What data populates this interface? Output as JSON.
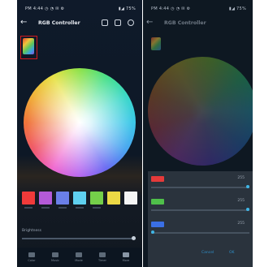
{
  "left_screen": {
    "status_left": "PM 4:44 ◷ ◔ ✉ ⚙",
    "status_right": "▮◢ 75%",
    "title": "RGB Controller",
    "swatches": [
      "#f03a3a",
      "#b45ad8",
      "#6a7fe8",
      "#5fd0f0",
      "#74cf4a",
      "#ecd845",
      "#f5f5f5"
    ],
    "brightness_label": "Brightness",
    "brightness_level": 1.0,
    "tabs": [
      "Color",
      "Music",
      "Mode",
      "Timer",
      "More"
    ]
  },
  "right_screen": {
    "status_left": "PM 4:44 ◷ ◔ ✉ ⚙",
    "status_right": "▮◢ 75%",
    "title": "RGB Controller",
    "rows": [
      {
        "color": "#e53a3a",
        "value": "255",
        "level": 1.0
      },
      {
        "color": "#4fbf4a",
        "value": "255",
        "level": 1.0
      },
      {
        "color": "#3a6fe5",
        "value": "255",
        "level": 0.0
      }
    ],
    "cancel_label": "Cancel",
    "ok_label": "OK"
  },
  "icons": [
    "back-arrow-icon",
    "mic-icon",
    "timer-icon",
    "more-icon"
  ]
}
